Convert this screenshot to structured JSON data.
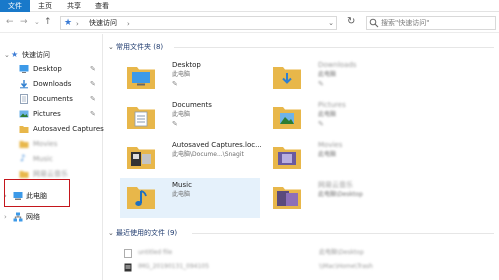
{
  "ribbon": {
    "tabs": [
      "文件",
      "主页",
      "共享",
      "查看"
    ]
  },
  "address": {
    "path": "快速访问",
    "separator": "›"
  },
  "search": {
    "placeholder": "搜索\"快速访问\""
  },
  "sidebar": {
    "quick_access": "快速访问",
    "items": [
      {
        "label": "Desktop",
        "pinned": true
      },
      {
        "label": "Downloads",
        "pinned": true
      },
      {
        "label": "Documents",
        "pinned": true
      },
      {
        "label": "Pictures",
        "pinned": true
      },
      {
        "label": "Autosaved Captures",
        "pinned": false
      },
      {
        "label": "Movies",
        "pinned": false
      },
      {
        "label": "Music",
        "pinned": false
      },
      {
        "label": "网易云音乐",
        "pinned": false
      }
    ],
    "this_pc": "此电脑",
    "network": "网络"
  },
  "frequent": {
    "header": "常用文件夹 (8)",
    "tiles": [
      {
        "name": "Desktop",
        "sub": "此电脑",
        "pinned": true,
        "blurred": false
      },
      {
        "name": "Downloads",
        "sub": "此电脑",
        "pinned": true,
        "blurred": true
      },
      {
        "name": "Documents",
        "sub": "此电脑",
        "pinned": true,
        "blurred": false
      },
      {
        "name": "Pictures",
        "sub": "此电脑",
        "pinned": true,
        "blurred": true
      },
      {
        "name": "Autosaved Captures.loc...",
        "sub": "此电脑\\Docume...\\Snagit",
        "pinned": false,
        "blurred": false
      },
      {
        "name": "Movies",
        "sub": "此电脑",
        "pinned": false,
        "blurred": true
      },
      {
        "name": "Music",
        "sub": "此电脑",
        "pinned": false,
        "blurred": false
      },
      {
        "name": "网易云音乐",
        "sub": "此电脑\\Desktop",
        "pinned": false,
        "blurred": true
      }
    ]
  },
  "recent": {
    "header": "最近使用的文件 (9)",
    "rows": [
      {
        "name": "untitled file",
        "location": "此电脑\\Desktop"
      },
      {
        "name": "IMG_20190131_094105",
        "location": "\\\\Mac\\Home\\Trash"
      }
    ]
  },
  "colors": {
    "accent": "#1979ca",
    "folder": "#e8b74a",
    "selection": "#e5f1fb",
    "highlight_box": "#c4161c"
  }
}
